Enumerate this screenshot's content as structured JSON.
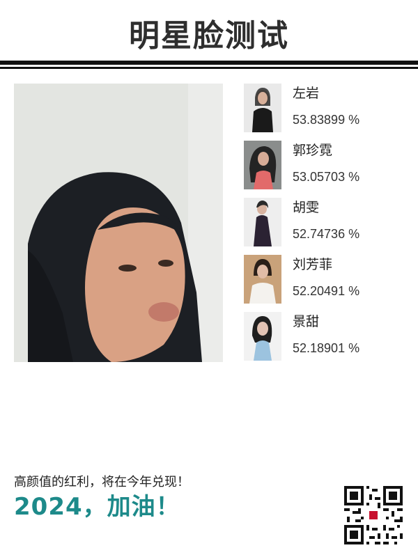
{
  "header": {
    "title": "明星脸测试"
  },
  "matches": [
    {
      "name": "左岩",
      "score": "53.83899 %"
    },
    {
      "name": "郭珍霓",
      "score": "53.05703 %"
    },
    {
      "name": "胡雯",
      "score": "52.74736 %"
    },
    {
      "name": "刘芳菲",
      "score": "52.20491 %"
    },
    {
      "name": "景甜",
      "score": "52.18901 %"
    }
  ],
  "footer": {
    "slogan": "高颜值的红利，将在今年兑现！",
    "cheer": "2024，加油！"
  },
  "colors": {
    "accent": "#1d8a8a",
    "rule": "#111111"
  }
}
